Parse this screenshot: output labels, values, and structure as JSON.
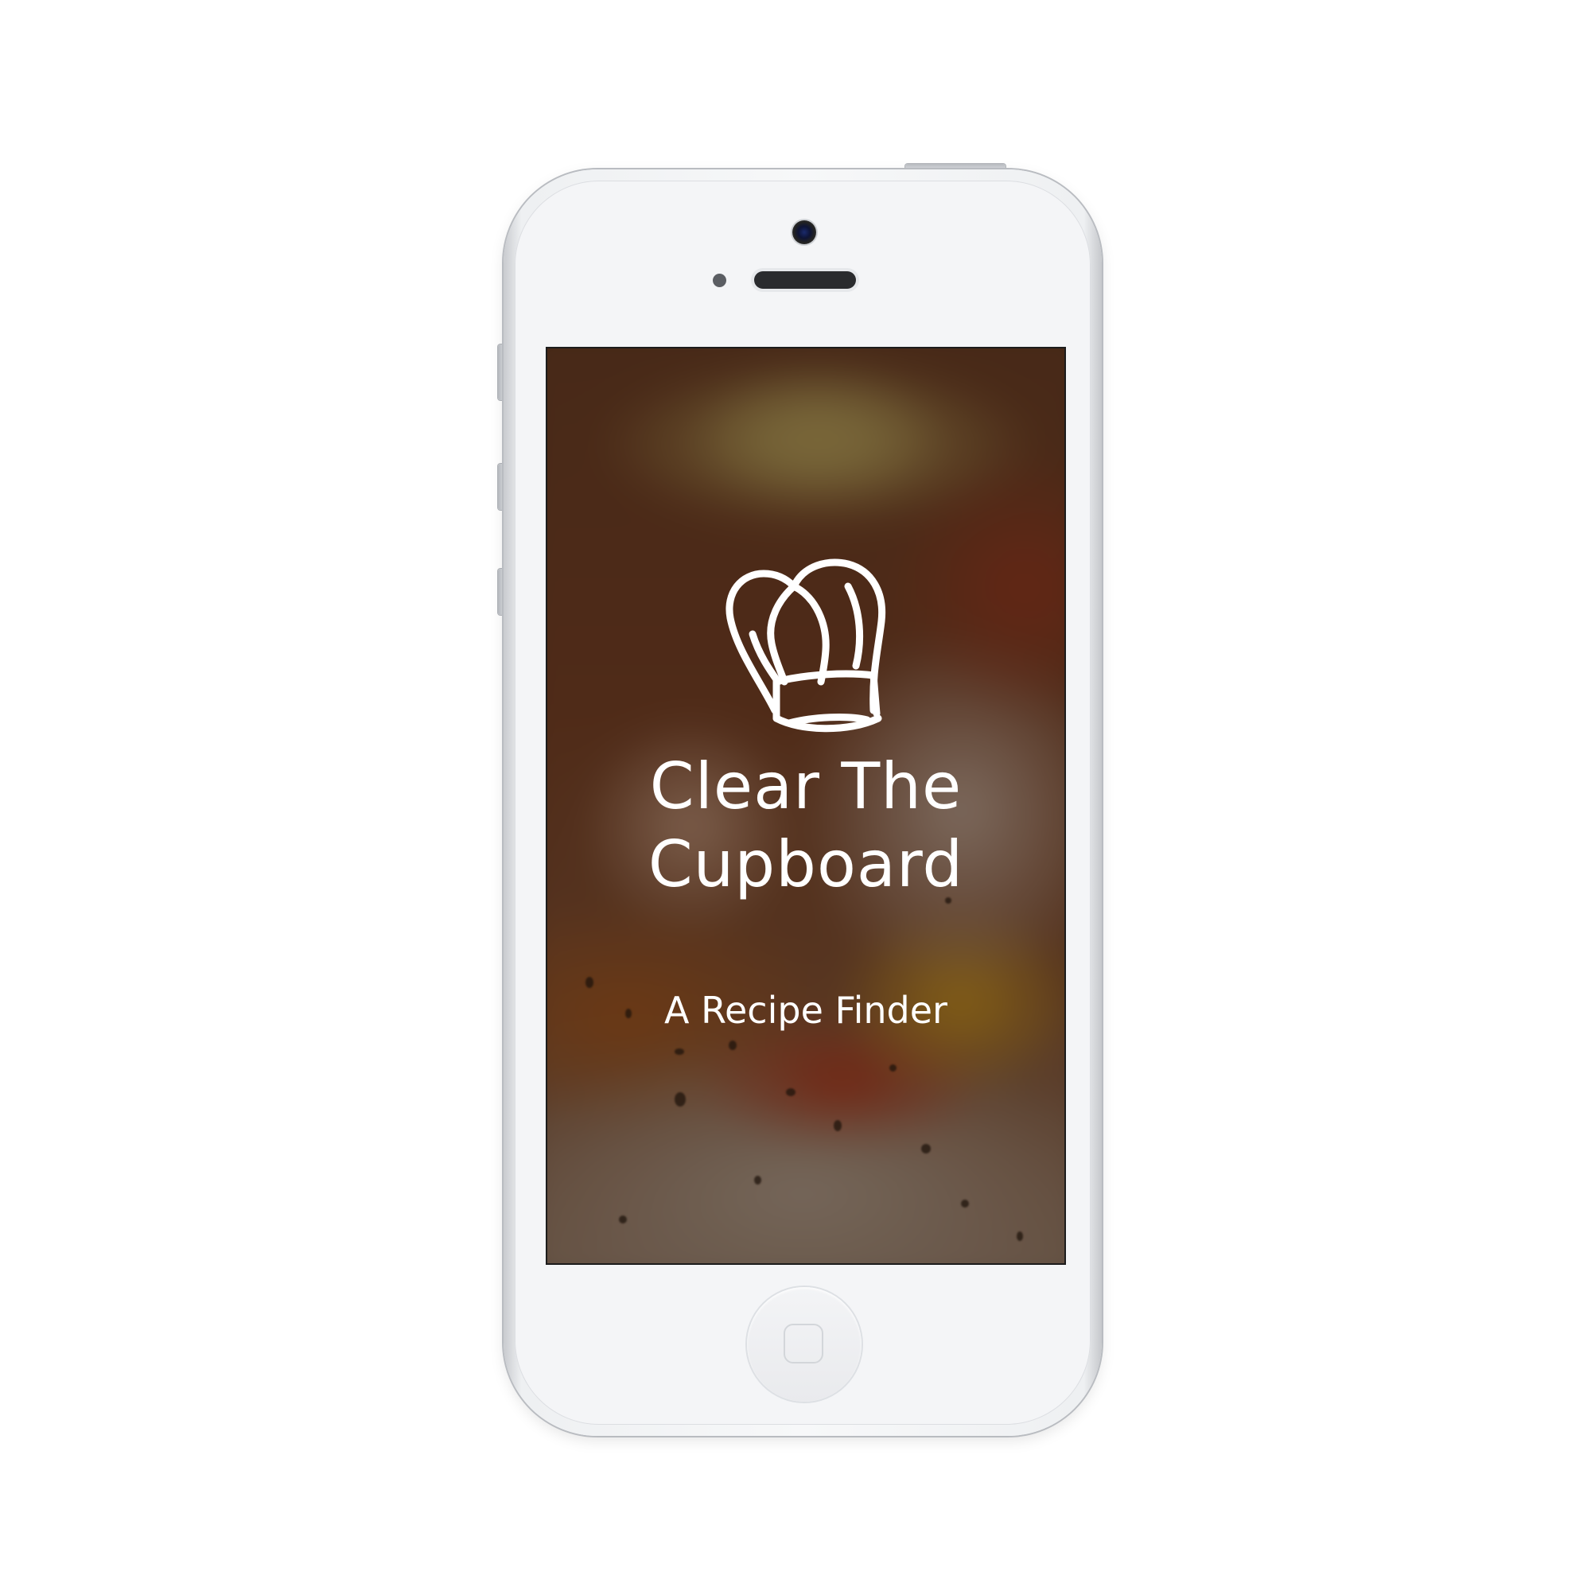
{
  "app": {
    "title_line1": "Clear The",
    "title_line2": "Cupboard",
    "subtitle": "A Recipe Finder",
    "logo_icon": "chef-hat-icon"
  },
  "device": {
    "type": "smartphone",
    "color": "#f4f5f7"
  },
  "colors": {
    "text": "#ffffff",
    "overlay": "#28160c"
  }
}
